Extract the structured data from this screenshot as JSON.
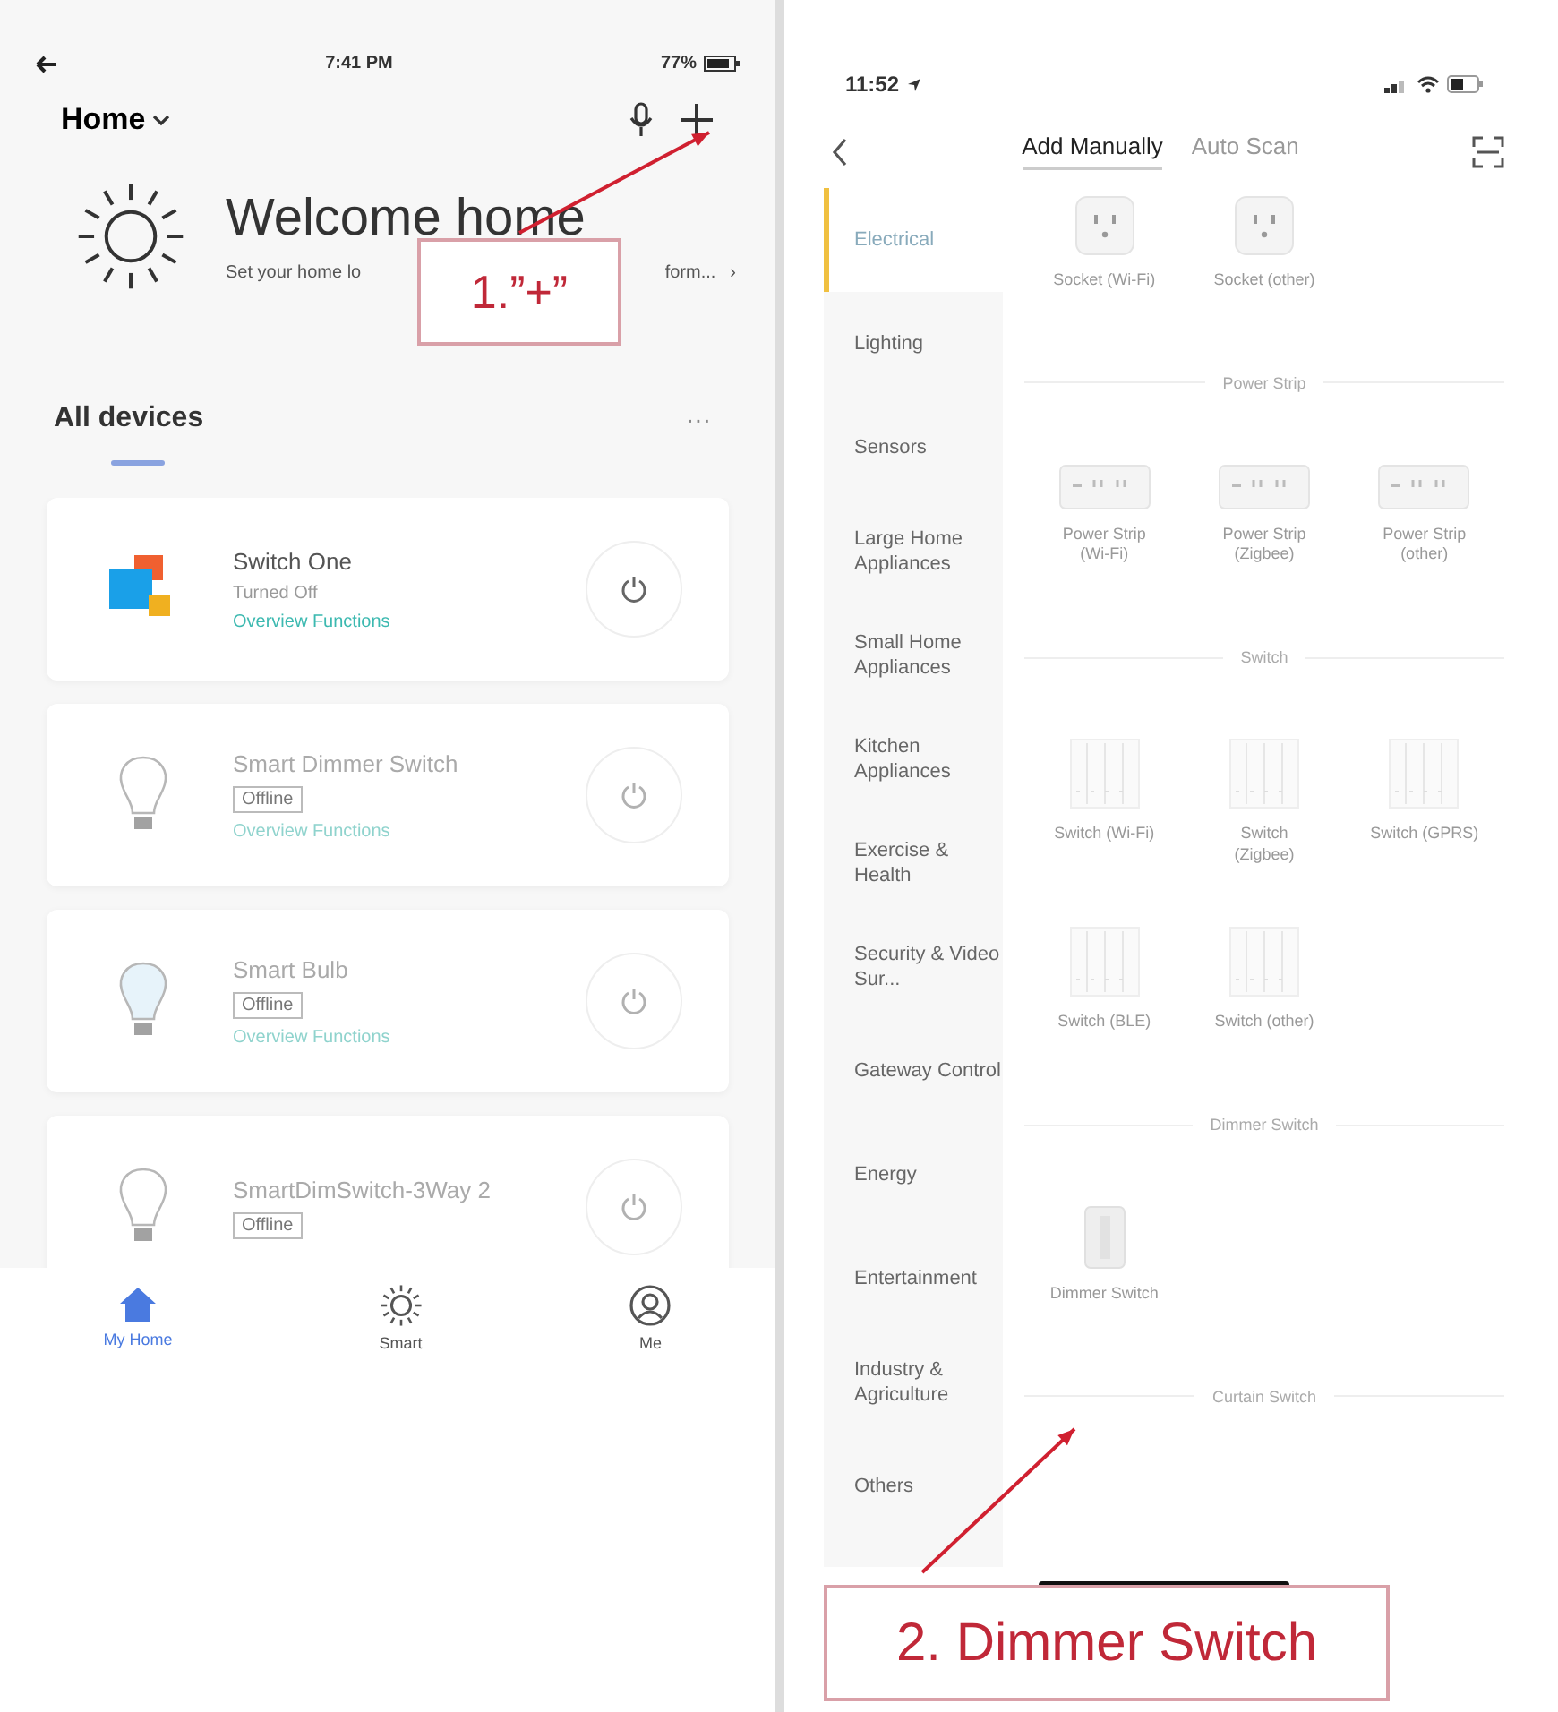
{
  "home_screen": {
    "status_bar": {
      "time": "7:41 PM",
      "battery": "77%"
    },
    "header": {
      "home_menu": "Home"
    },
    "welcome": {
      "title": "Welcome home",
      "subtitle_start": "Set your home lo",
      "subtitle_end": "form...",
      "chevron": "›"
    },
    "section": {
      "title": "All devices",
      "more": "···"
    },
    "devices": [
      {
        "name": "Switch One",
        "kind": "switch",
        "online": true,
        "status": "Turned Off",
        "link": "Overview Functions"
      },
      {
        "name": "Smart Dimmer Switch",
        "kind": "bulb",
        "online": false,
        "status": "Offline",
        "link": "Overview Functions"
      },
      {
        "name": "Smart Bulb",
        "kind": "tinted-bulb",
        "online": false,
        "status": "Offline",
        "link": "Overview Functions"
      },
      {
        "name": "SmartDimSwitch-3Way 2",
        "kind": "bulb",
        "online": false,
        "status": "Offline"
      }
    ],
    "tab_bar": [
      {
        "label": "My Home",
        "kind": "home",
        "selected": true
      },
      {
        "label": "Smart",
        "kind": "scenes",
        "selected": false
      },
      {
        "label": "Me",
        "kind": "profile",
        "selected": false
      }
    ]
  },
  "add_device_screen": {
    "status_bar": {
      "time": "11:52"
    },
    "tabs": [
      {
        "label": "Add Manually",
        "selected": true
      },
      {
        "label": "Auto Scan",
        "selected": false
      }
    ],
    "categories": [
      {
        "label": "Electrical",
        "selected": true
      },
      {
        "label": "Lighting",
        "selected": false
      },
      {
        "label": "Sensors",
        "selected": false
      },
      {
        "label": "Large Home Appliances",
        "selected": false
      },
      {
        "label": "Small Home Appliances",
        "selected": false
      },
      {
        "label": "Kitchen Appliances",
        "selected": false
      },
      {
        "label": "Exercise & Health",
        "selected": false
      },
      {
        "label": "Security & Video Sur...",
        "selected": false
      },
      {
        "label": "Gateway Control",
        "selected": false
      },
      {
        "label": "Energy",
        "selected": false
      },
      {
        "label": "Entertainment",
        "selected": false
      },
      {
        "label": "Industry & Agriculture",
        "selected": false
      },
      {
        "label": "Others",
        "selected": false
      }
    ],
    "sections": [
      {
        "items": [
          {
            "label": "Socket (Wi-Fi)",
            "kind": "socket"
          },
          {
            "label": "Socket (other)",
            "kind": "socket"
          }
        ]
      },
      {
        "title": "Power Strip",
        "items": [
          {
            "label": "Power Strip (Wi-Fi)",
            "kind": "strip"
          },
          {
            "label": "Power Strip (Zigbee)",
            "kind": "strip"
          },
          {
            "label": "Power Strip (other)",
            "kind": "strip"
          }
        ]
      },
      {
        "title": "Switch",
        "items": [
          {
            "label": "Switch (Wi-Fi)",
            "kind": "switch"
          },
          {
            "label": "Switch (Zigbee)",
            "kind": "switch"
          },
          {
            "label": "Switch (GPRS)",
            "kind": "switch"
          },
          {
            "label": "Switch (BLE)",
            "kind": "switch"
          },
          {
            "label": "Switch (other)",
            "kind": "switch"
          }
        ]
      },
      {
        "title": "Dimmer Switch",
        "items": [
          {
            "label": "Dimmer Switch",
            "kind": "dimmer"
          }
        ]
      },
      {
        "title": "Curtain Switch"
      }
    ]
  },
  "annotations": [
    {
      "label": "1.”+”"
    },
    {
      "label": "2. Dimmer Switch"
    }
  ]
}
